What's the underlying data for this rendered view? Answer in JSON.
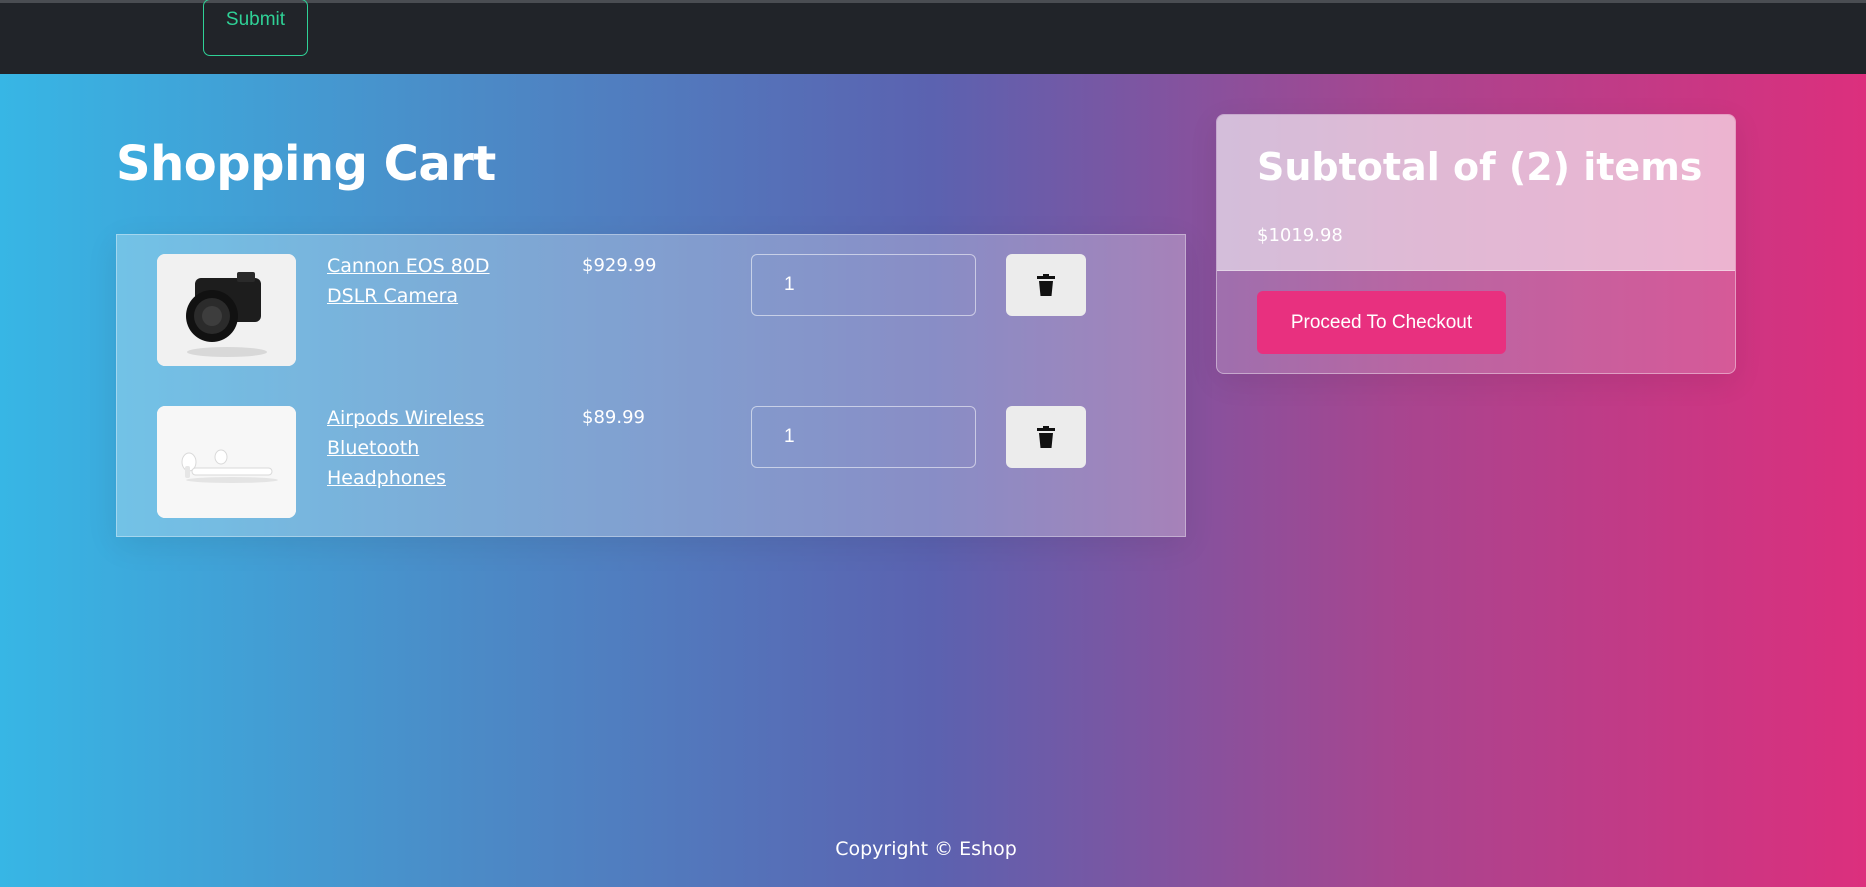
{
  "navbar": {
    "submit_label": "Submit"
  },
  "page_title": "Shopping Cart",
  "cart": {
    "items": [
      {
        "name": "Cannon EOS 80D DSLR Camera",
        "price": "$929.99",
        "qty": "1",
        "image_icon": "camera-image"
      },
      {
        "name": "Airpods Wireless Bluetooth Headphones",
        "price": "$89.99",
        "qty": "1",
        "image_icon": "airpods-image"
      }
    ]
  },
  "summary": {
    "title": "Subtotal of (2) items",
    "total": "$1019.98",
    "checkout_label": "Proceed To Checkout"
  },
  "footer": {
    "text": "Copyright © Eshop"
  },
  "colors": {
    "accent_green": "#2fd196",
    "checkout_pink": "#e8307f",
    "navbar_bg": "#212429",
    "gradient_start": "#37b6e5",
    "gradient_end": "#dc2f7d"
  }
}
